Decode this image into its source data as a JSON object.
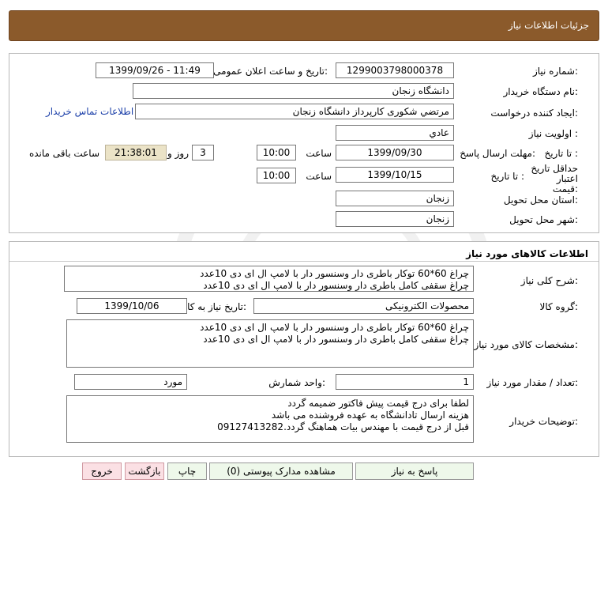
{
  "header": {
    "title": "جزئیات اطلاعات نیاز"
  },
  "info": {
    "need_number_label": "شماره نیاز:",
    "need_number": "1299003798000378",
    "announce_label": "تاریخ و ساعت اعلان عمومی:",
    "announce_value": "1399/09/26 - 11:49",
    "buyer_org_label": "نام دستگاه خریدار:",
    "buyer_org": "دانشگاه زنجان",
    "creator_label": "ایجاد کننده درخواست:",
    "creator": "مرتضي شکوری کارپرداز دانشگاه زنجان",
    "contact_link": "اطلاعات تماس خریدار",
    "priority_label": "اولویت نیاز :",
    "priority": "عادي",
    "deadline_label": "مهلت ارسال پاسخ:",
    "to_date_label": "تا تاریخ :",
    "deadline_date": "1399/09/30",
    "time_label": "ساعت",
    "deadline_time": "10:00",
    "days_value": "3",
    "days_label": "روز و",
    "remaining_time": "21:38:01",
    "remaining_label": "ساعت باقی مانده",
    "validity_label": "حداقل تاریخ اعتبار قیمت:",
    "validity_to_label": "تا تاریخ :",
    "validity_date": "1399/10/15",
    "validity_time_label": "ساعت",
    "validity_time": "10:00",
    "province_label": "استان محل تحویل:",
    "province": "زنجان",
    "city_label": "شهر محل تحویل:",
    "city": "زنجان"
  },
  "goods": {
    "section_title": "اطلاعات کالاهای مورد نیاز",
    "summary_label": "شرح کلی نیاز:",
    "summary_lines": [
      "چراغ 60*60 توکار باطری دار وسنسور دار با لامپ ال ای دی 10عدد",
      "چراغ سقفی کامل باطری دار وسنسور دار با لامپ ال ای دی 10عدد"
    ],
    "group_label": "گروه کالا:",
    "group": "محصولات الکترونیکی",
    "need_date_label": "تاریخ نیاز به کالا:",
    "need_date": "1399/10/06",
    "spec_label": "مشخصات کالای مورد نیاز:",
    "spec_lines": [
      "چراغ 60*60 توکار باطری دار وسنسور دار با لامپ ال ای دی 10عدد",
      "چراغ سقفی کامل باطری دار وسنسور دار با لامپ ال ای دی 10عدد"
    ],
    "qty_label": "تعداد / مقدار مورد نیاز:",
    "qty": "1",
    "unit_label": "واحد شمارش:",
    "unit": "مورد",
    "notes_label": "توضیحات خریدار:",
    "notes_lines": [
      "لطفا برای درج قیمت پیش فاکتور ضمیمه گردد",
      "هزینه ارسال تادانشگاه به عهده فروشنده می باشد",
      "قبل از درج قیمت با مهندس بیات هماهنگ گردد.09127413282"
    ]
  },
  "buttons": {
    "reply": "پاسخ به نیاز",
    "attachments": "مشاهده مدارک پیوستی (0)",
    "print": "چاپ",
    "back": "بازگشت",
    "exit": "خروج"
  },
  "colors": {
    "header_bg": "#8b5a2b",
    "remaining_bg": "#ebe3c7",
    "link": "#1a3ea8",
    "button_green": "#eef8ea",
    "button_red": "#fbe0e4"
  }
}
